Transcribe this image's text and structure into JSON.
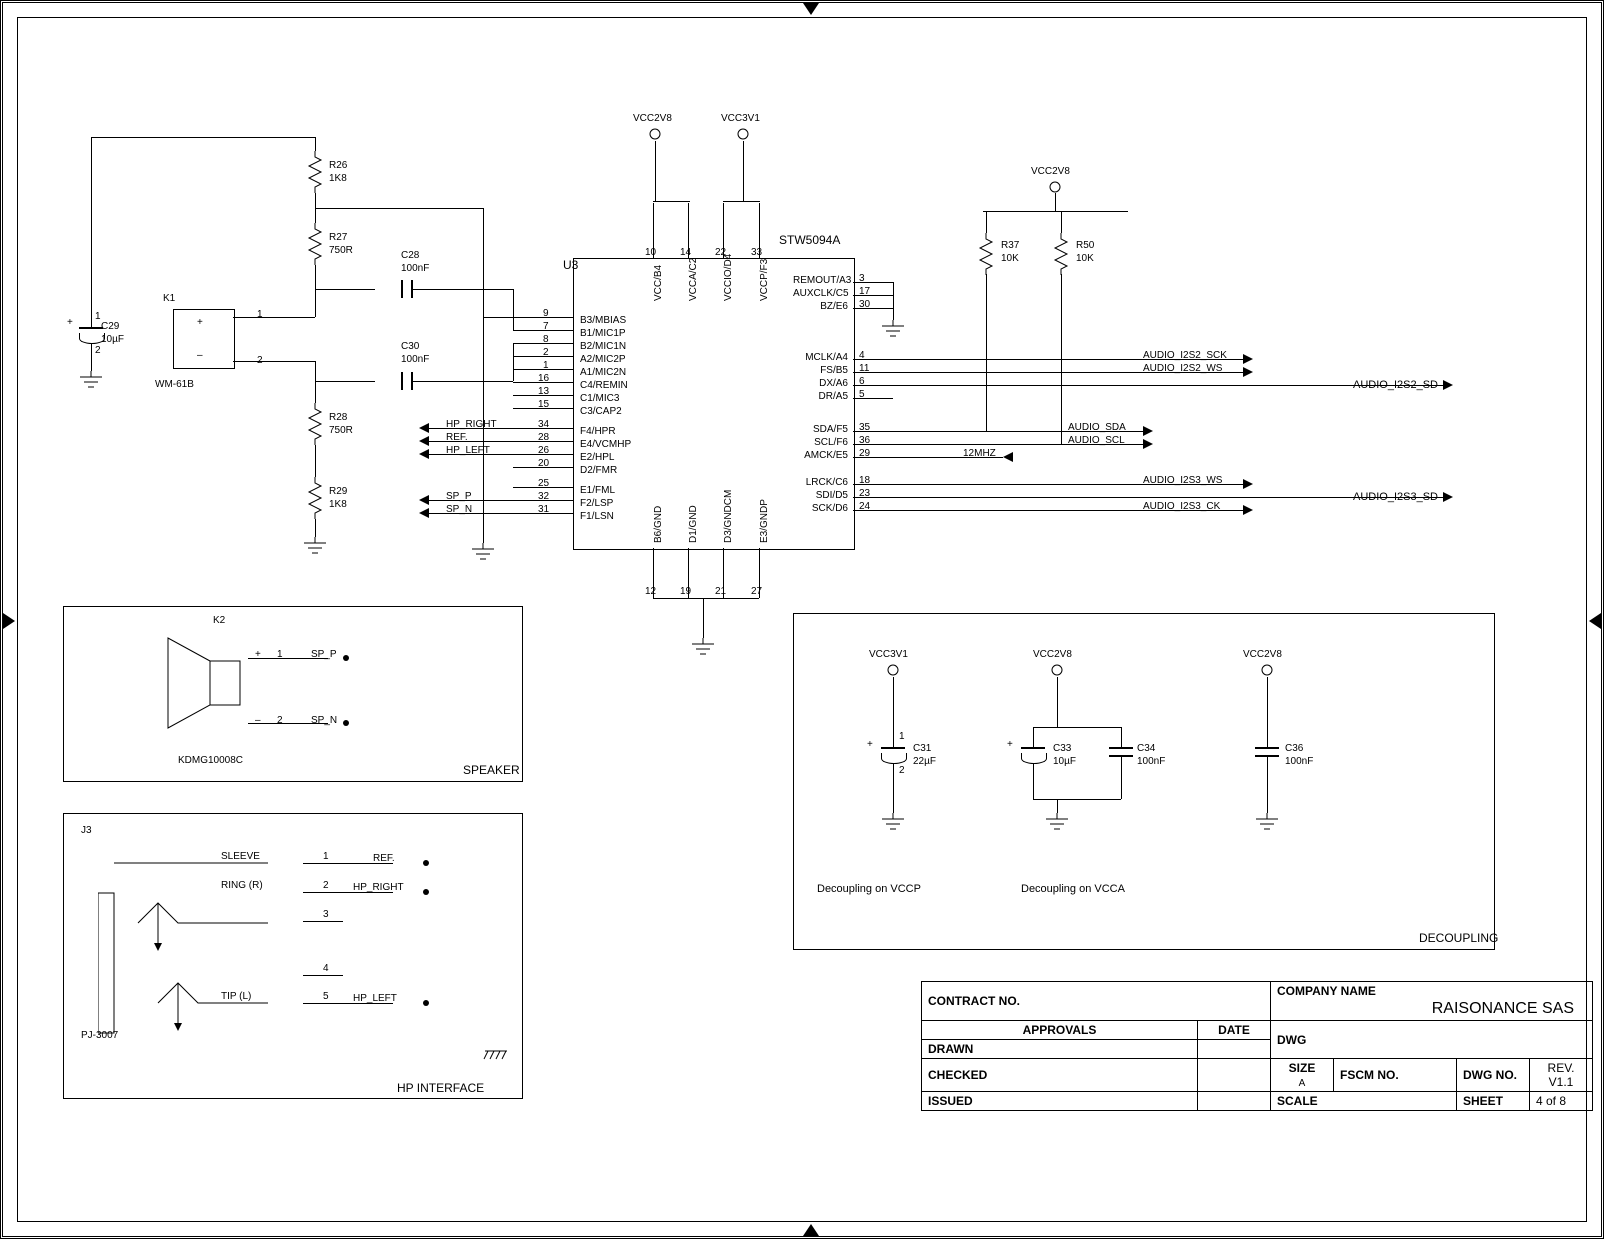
{
  "title_block": {
    "contract_no": {
      "label": "CONTRACT NO.",
      "value": ""
    },
    "company": {
      "label": "COMPANY NAME",
      "value": "RAISONANCE SAS"
    },
    "approvals": "APPROVALS",
    "date": "DATE",
    "dwg": "DWG",
    "drawn": "DRAWN",
    "checked": "CHECKED",
    "issued": "ISSUED",
    "size": {
      "label": "SIZE",
      "value": "A"
    },
    "fscm": "FSCM NO.",
    "dwgno": "DWG NO.",
    "rev": {
      "label": "REV.",
      "value": "V1.1"
    },
    "scale": "SCALE",
    "sheet": {
      "label": "SHEET",
      "value": "4 of 8"
    }
  },
  "ic": {
    "ref": "U3",
    "part": "STW5094A",
    "left": [
      {
        "pin": "9",
        "name": "B3/MBIAS"
      },
      {
        "pin": "7",
        "name": "B1/MIC1P"
      },
      {
        "pin": "8",
        "name": "B2/MIC1N"
      },
      {
        "pin": "2",
        "name": "A2/MIC2P"
      },
      {
        "pin": "1",
        "name": "A1/MIC2N"
      },
      {
        "pin": "16",
        "name": "C4/REMIN"
      },
      {
        "pin": "13",
        "name": "C1/MIC3"
      },
      {
        "pin": "15",
        "name": "C3/CAP2"
      },
      {
        "pin": "34",
        "name": "F4/HPR"
      },
      {
        "pin": "28",
        "name": "E4/VCMHP"
      },
      {
        "pin": "26",
        "name": "E2/HPL"
      },
      {
        "pin": "20",
        "name": "D2/FMR"
      },
      {
        "pin": "25",
        "name": "E1/FML"
      },
      {
        "pin": "32",
        "name": "F2/LSP"
      },
      {
        "pin": "31",
        "name": "F1/LSN"
      }
    ],
    "top": [
      {
        "pin": "10",
        "name": "VCC/B4"
      },
      {
        "pin": "14",
        "name": "VCCA/C2"
      },
      {
        "pin": "22",
        "name": "VCCIO/D4"
      },
      {
        "pin": "33",
        "name": "VCCP/F3"
      }
    ],
    "bottom": [
      {
        "pin": "12",
        "name": "B6/GND"
      },
      {
        "pin": "19",
        "name": "D1/GND"
      },
      {
        "pin": "21",
        "name": "D3/GNDCM"
      },
      {
        "pin": "27",
        "name": "E3/GNDP"
      }
    ],
    "right": [
      {
        "pin": "3",
        "name": "REMOUT/A3"
      },
      {
        "pin": "17",
        "name": "AUXCLK/C5"
      },
      {
        "pin": "30",
        "name": "BZ/E6"
      },
      {
        "pin": "4",
        "name": "MCLK/A4"
      },
      {
        "pin": "11",
        "name": "FS/B5"
      },
      {
        "pin": "6",
        "name": "DX/A6"
      },
      {
        "pin": "5",
        "name": "DR/A5"
      },
      {
        "pin": "35",
        "name": "SDA/F5"
      },
      {
        "pin": "36",
        "name": "SCL/F6"
      },
      {
        "pin": "29",
        "name": "AMCK/E5"
      },
      {
        "pin": "18",
        "name": "LRCK/C6"
      },
      {
        "pin": "23",
        "name": "SDI/D5"
      },
      {
        "pin": "24",
        "name": "SCK/D6"
      }
    ]
  },
  "power": {
    "vcc2v8": "VCC2V8",
    "vcc3v1": "VCC3V1"
  },
  "components": {
    "R26": {
      "ref": "R26",
      "val": "1K8"
    },
    "R27": {
      "ref": "R27",
      "val": "750R"
    },
    "R28": {
      "ref": "R28",
      "val": "750R"
    },
    "R29": {
      "ref": "R29",
      "val": "1K8"
    },
    "R37": {
      "ref": "R37",
      "val": "10K"
    },
    "R50": {
      "ref": "R50",
      "val": "10K"
    },
    "C28": {
      "ref": "C28",
      "val": "100nF"
    },
    "C29": {
      "ref": "C29",
      "val": "10µF"
    },
    "C30": {
      "ref": "C30",
      "val": "100nF"
    },
    "C31": {
      "ref": "C31",
      "val": "22µF"
    },
    "C33": {
      "ref": "C33",
      "val": "10µF"
    },
    "C34": {
      "ref": "C34",
      "val": "100nF"
    },
    "C36": {
      "ref": "C36",
      "val": "100nF"
    },
    "K1": {
      "ref": "K1",
      "val": "WM-61B"
    },
    "K2": {
      "ref": "K2",
      "val": "KDMG10008C"
    },
    "J3": {
      "ref": "J3",
      "val": "PJ-3007"
    }
  },
  "nets": {
    "hp_right": "HP_RIGHT",
    "hp_left": "HP_LEFT",
    "ref": "REF.",
    "sp_p": "SP_P",
    "sp_n": "SP_N",
    "audio_i2s2_sck": "AUDIO_I2S2_SCK",
    "audio_i2s2_ws": "AUDIO_I2S2_WS",
    "audio_i2s2_sd": "AUDIO_I2S2_SD",
    "audio_sda": "AUDIO_SDA",
    "audio_scl": "AUDIO_SCL",
    "twelve": "12MHZ",
    "audio_i2s3_ws": "AUDIO_I2S3_WS",
    "audio_i2s3_sd": "AUDIO_I2S3_SD",
    "audio_i2s3_ck": "AUDIO_I2S3_CK"
  },
  "labels": {
    "speaker_box": "SPEAKER",
    "hp_box": "HP INTERFACE",
    "decoupling": "DECOUPLING",
    "dec1": "Decoupling on VCCP",
    "dec2": "Decoupling on VCCA",
    "sleeve": "SLEEVE",
    "ring": "RING (R)",
    "tip": "TIP (L)"
  },
  "polarity": {
    "plus": "+",
    "one": "1",
    "two": "2"
  }
}
